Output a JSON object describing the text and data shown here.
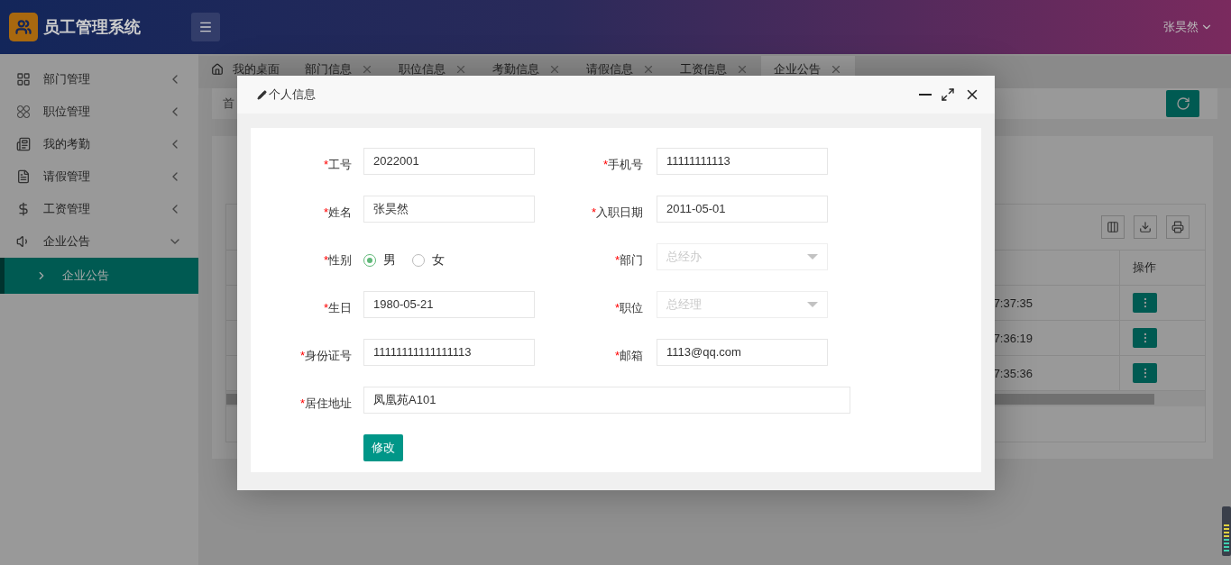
{
  "app": {
    "title": "员工管理系统",
    "user": "张昊然"
  },
  "sidebar": {
    "items": [
      {
        "label": "部门管理",
        "expanded": false
      },
      {
        "label": "职位管理",
        "expanded": false
      },
      {
        "label": "我的考勤",
        "expanded": false
      },
      {
        "label": "请假管理",
        "expanded": false
      },
      {
        "label": "工资管理",
        "expanded": false
      },
      {
        "label": "企业公告",
        "expanded": true,
        "children": [
          {
            "label": "企业公告",
            "selected": true
          }
        ]
      }
    ]
  },
  "tabs": [
    {
      "label": "我的桌面",
      "kind": "home",
      "selected": false
    },
    {
      "label": "部门信息",
      "kind": "closable",
      "selected": false
    },
    {
      "label": "职位信息",
      "kind": "closable",
      "selected": false
    },
    {
      "label": "考勤信息",
      "kind": "closable",
      "selected": false
    },
    {
      "label": "请假信息",
      "kind": "closable",
      "selected": false
    },
    {
      "label": "工资信息",
      "kind": "closable",
      "selected": false
    },
    {
      "label": "企业公告",
      "kind": "closable",
      "selected": true
    }
  ],
  "breadcrumb": "首",
  "table": {
    "columns": [
      "操作"
    ],
    "rows": [
      {
        "column_1": "7:37:35"
      },
      {
        "column_1": "7:36:19"
      },
      {
        "column_1": "7:35:36"
      }
    ]
  },
  "dialog": {
    "title": "个人信息",
    "rows": [
      [
        {
          "marker": "*",
          "label": "工号",
          "kind": "text",
          "disabled": false,
          "value": "2022001"
        },
        {
          "marker": "*",
          "label": "手机号",
          "kind": "text",
          "disabled": false,
          "value": "11111111113"
        }
      ],
      [
        {
          "marker": "*",
          "label": "姓名",
          "kind": "text",
          "disabled": false,
          "value": "张昊然"
        },
        {
          "marker": "*",
          "label": "入职日期",
          "kind": "text",
          "disabled": false,
          "value": "2011-05-01"
        }
      ],
      [
        {
          "marker": "*",
          "label": "性别",
          "kind": "radio",
          "options": [
            {
              "label": "男",
              "selected": true
            },
            {
              "label": "女",
              "selected": false
            }
          ]
        },
        {
          "marker": "*",
          "label": "部门",
          "kind": "select",
          "disabled": true,
          "value": "总经办"
        }
      ],
      [
        {
          "marker": "*",
          "label": "生日",
          "kind": "text",
          "disabled": false,
          "value": "1980-05-21"
        },
        {
          "marker": "*",
          "label": "职位",
          "kind": "select",
          "disabled": true,
          "value": "总经理"
        }
      ],
      [
        {
          "marker": "*",
          "label": "身份证号",
          "kind": "text",
          "disabled": false,
          "value": "11111111111111113"
        },
        {
          "marker": "*",
          "label": "邮箱",
          "kind": "text",
          "disabled": false,
          "value": "1113@qq.com"
        }
      ],
      [
        {
          "marker": "*",
          "label": "居住地址",
          "kind": "text",
          "disabled": false,
          "value": "凤凰苑A101"
        }
      ]
    ],
    "submit": "修改"
  }
}
